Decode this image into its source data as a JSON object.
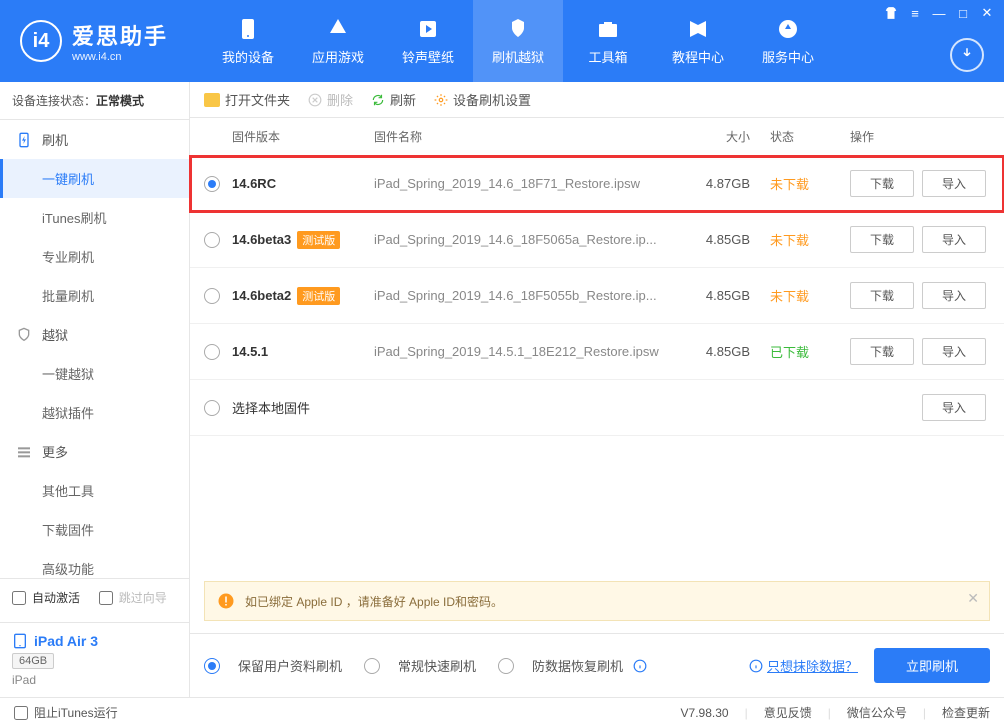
{
  "app": {
    "title": "爱思助手",
    "subtitle": "www.i4.cn"
  },
  "nav": [
    {
      "label": "我的设备"
    },
    {
      "label": "应用游戏"
    },
    {
      "label": "铃声壁纸"
    },
    {
      "label": "刷机越狱",
      "active": true
    },
    {
      "label": "工具箱"
    },
    {
      "label": "教程中心"
    },
    {
      "label": "服务中心"
    }
  ],
  "sidebar": {
    "status_label": "设备连接状态：",
    "status_value": "正常模式",
    "groups": [
      {
        "icon": "flash",
        "label": "刷机",
        "items": [
          {
            "label": "一键刷机",
            "active": true
          },
          {
            "label": "iTunes刷机"
          },
          {
            "label": "专业刷机"
          },
          {
            "label": "批量刷机"
          }
        ]
      },
      {
        "icon": "shield",
        "label": "越狱",
        "items": [
          {
            "label": "一键越狱"
          },
          {
            "label": "越狱插件"
          }
        ]
      },
      {
        "icon": "more",
        "label": "更多",
        "items": [
          {
            "label": "其他工具"
          },
          {
            "label": "下载固件"
          },
          {
            "label": "高级功能"
          }
        ]
      }
    ],
    "auto_activate": "自动激活",
    "skip_wizard": "跳过向导",
    "device": {
      "name": "iPad Air 3",
      "capacity": "64GB",
      "type": "iPad"
    }
  },
  "toolbar": {
    "open_folder": "打开文件夹",
    "delete": "删除",
    "refresh": "刷新",
    "settings": "设备刷机设置"
  },
  "table": {
    "headers": {
      "version": "固件版本",
      "name": "固件名称",
      "size": "大小",
      "status": "状态",
      "action": "操作"
    },
    "download_btn": "下载",
    "import_btn": "导入",
    "local_label": "选择本地固件",
    "rows": [
      {
        "version": "14.6RC",
        "badge": "",
        "name": "iPad_Spring_2019_14.6_18F71_Restore.ipsw",
        "size": "4.87GB",
        "status": "未下载",
        "status_cls": "no",
        "selected": true,
        "highlight": true
      },
      {
        "version": "14.6beta3",
        "badge": "测试版",
        "name": "iPad_Spring_2019_14.6_18F5065a_Restore.ip...",
        "size": "4.85GB",
        "status": "未下载",
        "status_cls": "no"
      },
      {
        "version": "14.6beta2",
        "badge": "测试版",
        "name": "iPad_Spring_2019_14.6_18F5055b_Restore.ip...",
        "size": "4.85GB",
        "status": "未下载",
        "status_cls": "no"
      },
      {
        "version": "14.5.1",
        "badge": "",
        "name": "iPad_Spring_2019_14.5.1_18E212_Restore.ipsw",
        "size": "4.85GB",
        "status": "已下载",
        "status_cls": "yes"
      }
    ]
  },
  "warning": "如已绑定 Apple ID ，请准备好 Apple ID和密码。",
  "options": {
    "opt1": "保留用户资料刷机",
    "opt2": "常规快速刷机",
    "opt3": "防数据恢复刷机",
    "erase_link": "只想抹除数据？",
    "flash_btn": "立即刷机"
  },
  "footer": {
    "block_itunes": "阻止iTunes运行",
    "version": "V7.98.30",
    "feedback": "意见反馈",
    "wechat": "微信公众号",
    "update": "检查更新"
  }
}
